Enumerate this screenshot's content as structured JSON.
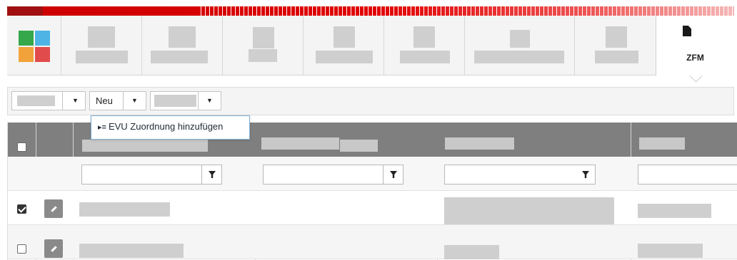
{
  "nav": {
    "active_tab_label": "ZFM",
    "logo_colors": [
      "#34a84a",
      "#4db4e5",
      "#f2a23a",
      "#e24b4b"
    ]
  },
  "toolbar": {
    "new_label": "Neu"
  },
  "popup": {
    "item_label": "EVU Zuordnung hinzufügen"
  },
  "grid": {
    "header_color": "#7f7f7f",
    "rows": [
      {
        "selected": true
      },
      {
        "selected": false
      }
    ]
  },
  "colors": {
    "brand_red": "#cc0000",
    "accent_blue": "#7fb0d6"
  }
}
